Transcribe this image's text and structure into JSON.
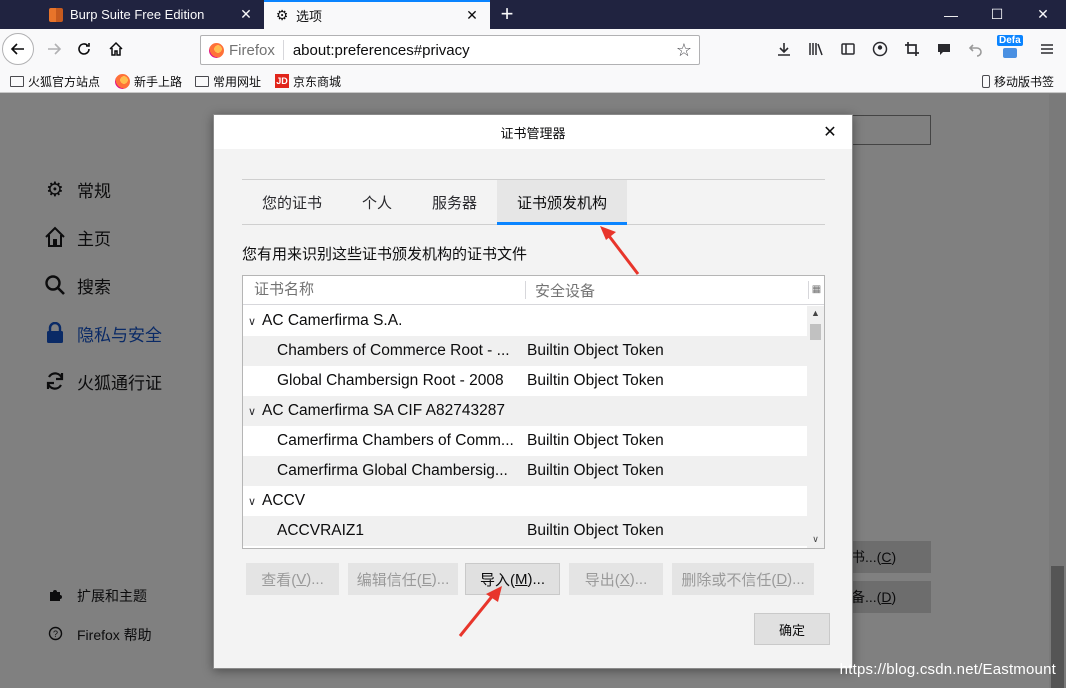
{
  "browser": {
    "tabs": [
      {
        "title": "Burp Suite Free Edition",
        "icon": "burp-icon"
      },
      {
        "title": "选项",
        "icon": "gear-icon"
      }
    ],
    "url_identity": "Firefox",
    "url": "about:preferences#privacy",
    "badge": "Defa",
    "bookmarks": [
      {
        "label": "火狐官方站点",
        "icon": "folder-icon"
      },
      {
        "label": "新手上路",
        "icon": "firefox-icon"
      },
      {
        "label": "常用网址",
        "icon": "folder-icon"
      },
      {
        "label": "京东商城",
        "icon": "jd-icon"
      }
    ],
    "mobile_bookmarks": "移动版书签"
  },
  "sidebar": {
    "items": [
      {
        "label": "常规",
        "icon": "gear-icon"
      },
      {
        "label": "主页",
        "icon": "home-icon"
      },
      {
        "label": "搜索",
        "icon": "search-icon"
      },
      {
        "label": "隐私与安全",
        "icon": "lock-icon",
        "active": true
      },
      {
        "label": "火狐通行证",
        "icon": "sync-icon"
      }
    ],
    "footer": [
      {
        "label": "扩展和主题",
        "icon": "puzzle-icon"
      },
      {
        "label": "Firefox 帮助",
        "icon": "help-icon"
      }
    ]
  },
  "background_buttons": {
    "certs": {
      "prefix": "书...(",
      "key": "C",
      "suffix": ")"
    },
    "devices": {
      "prefix": "备...(",
      "key": "D",
      "suffix": ")"
    }
  },
  "dialog": {
    "title": "证书管理器",
    "tabs": [
      "您的证书",
      "个人",
      "服务器",
      "证书颁发机构"
    ],
    "selected_tab": "证书颁发机构",
    "description": "您有用来识别这些证书颁发机构的证书文件",
    "columns": {
      "name": "证书名称",
      "device": "安全设备"
    },
    "rows": [
      {
        "type": "group",
        "name": "AC Camerfirma S.A.",
        "device": ""
      },
      {
        "type": "child",
        "name": "Chambers of Commerce Root - ...",
        "device": "Builtin Object Token"
      },
      {
        "type": "child",
        "name": "Global Chambersign Root - 2008",
        "device": "Builtin Object Token"
      },
      {
        "type": "group",
        "name": "AC Camerfirma SA CIF A82743287",
        "device": ""
      },
      {
        "type": "child",
        "name": "Camerfirma Chambers of Comm...",
        "device": "Builtin Object Token"
      },
      {
        "type": "child",
        "name": "Camerfirma Global Chambersig...",
        "device": "Builtin Object Token"
      },
      {
        "type": "group",
        "name": "ACCV",
        "device": ""
      },
      {
        "type": "child",
        "name": "ACCVRAIZ1",
        "device": "Builtin Object Token"
      }
    ],
    "buttons": {
      "view": {
        "prefix": "查看(",
        "key": "V",
        "suffix": ")..."
      },
      "edit_trust": {
        "prefix": "编辑信任(",
        "key": "E",
        "suffix": ")..."
      },
      "import": {
        "prefix": "导入(",
        "key": "M",
        "suffix": ")..."
      },
      "export": {
        "prefix": "导出(",
        "key": "X",
        "suffix": ")..."
      },
      "delete": {
        "prefix": "删除或不信任(",
        "key": "D",
        "suffix": ")..."
      }
    },
    "ok": "确定"
  },
  "watermark": "https://blog.csdn.net/Eastmount",
  "colors": {
    "accent": "#0a84ff",
    "tabbar": "#202340",
    "arrow": "#e8352b"
  }
}
